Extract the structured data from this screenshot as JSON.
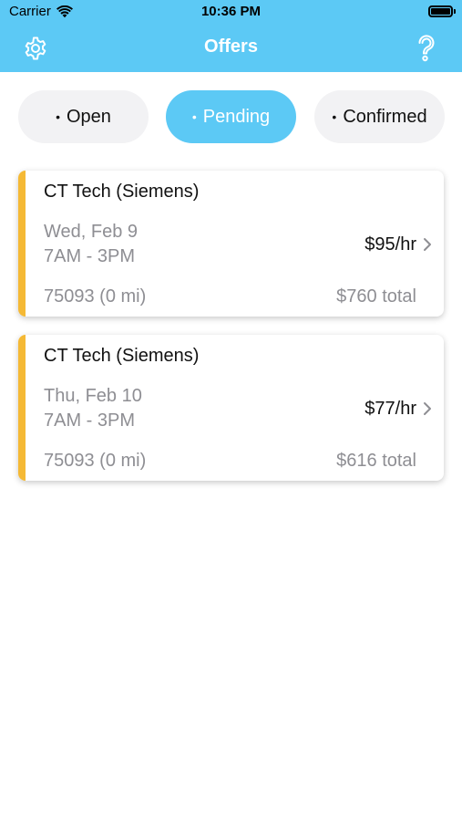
{
  "status_bar": {
    "carrier": "Carrier",
    "time": "10:36 PM"
  },
  "nav": {
    "title": "Offers",
    "left_icon": "gear-icon",
    "right_icon": "question-mark-icon"
  },
  "filters": {
    "items": [
      {
        "dot": "•",
        "label": "Open",
        "active": false
      },
      {
        "dot": "•",
        "label": "Pending",
        "active": true
      },
      {
        "dot": "•",
        "label": "Confirmed",
        "active": false
      }
    ]
  },
  "offers": [
    {
      "title": "CT Tech (Siemens)",
      "date": "Wed, Feb 9",
      "time": "7AM - 3PM",
      "rate": "$95/hr",
      "location": "75093 (0 mi)",
      "total": "$760 total"
    },
    {
      "title": "CT Tech (Siemens)",
      "date": "Thu, Feb 10",
      "time": "7AM - 3PM",
      "rate": "$77/hr",
      "location": "75093 (0 mi)",
      "total": "$616 total"
    }
  ],
  "colors": {
    "brand": "#5cc9f5",
    "accent_stripe": "#f5b935",
    "muted_text": "#8e8e93",
    "pill_bg": "#f2f2f4"
  }
}
